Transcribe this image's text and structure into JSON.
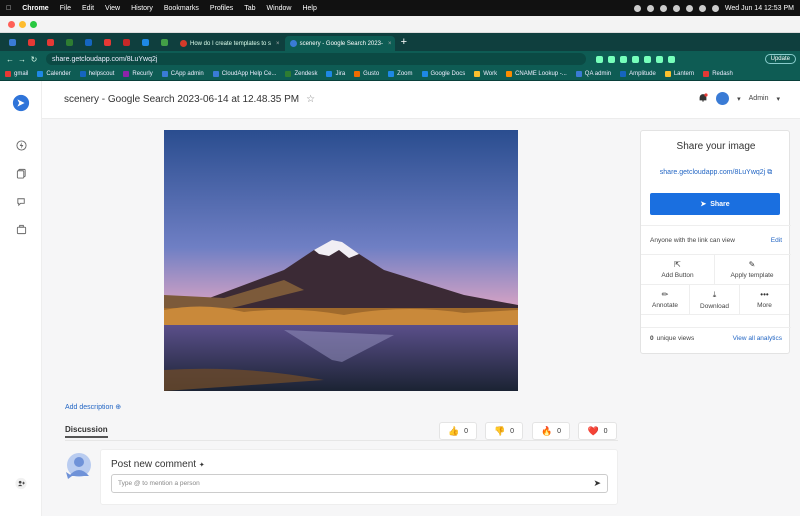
{
  "menubar": {
    "app_name": "Chrome",
    "items": [
      "File",
      "Edit",
      "View",
      "History",
      "Bookmarks",
      "Profiles",
      "Tab",
      "Window",
      "Help"
    ],
    "clock": "Wed Jun 14  12:53 PM"
  },
  "tabs": [
    {
      "label": "How do I create templates to s",
      "color": "#d43b2a",
      "active": false
    },
    {
      "label": "scenery - Google Search 2023-",
      "color": "#3a7bd5",
      "active": true
    }
  ],
  "pinned_tab_colors": [
    "#3a7bd5",
    "#e53935",
    "#e53935",
    "#2e7d32",
    "#1565c0",
    "#e53935",
    "#c62828",
    "#1e88e5",
    "#43a047"
  ],
  "address": {
    "url": "share.getcloudapp.com/8LuYwq2j",
    "update_label": "Update"
  },
  "bookmarks": [
    {
      "label": "gmail",
      "color": "#e53935"
    },
    {
      "label": "Calender",
      "color": "#1e88e5"
    },
    {
      "label": "helpscout",
      "color": "#1565c0"
    },
    {
      "label": "Recurly",
      "color": "#8e24aa"
    },
    {
      "label": "CApp admin",
      "color": "#3a7bd5"
    },
    {
      "label": "CloudApp Help Ce...",
      "color": "#3a7bd5"
    },
    {
      "label": "Zendesk",
      "color": "#2e7d32"
    },
    {
      "label": "Jira",
      "color": "#1e88e5"
    },
    {
      "label": "Gusto",
      "color": "#ef6c00"
    },
    {
      "label": "Zoom",
      "color": "#1e88e5"
    },
    {
      "label": "Google Docs",
      "color": "#1e88e5"
    },
    {
      "label": "Work",
      "color": "#fbc02d"
    },
    {
      "label": "CNAME Lookup -...",
      "color": "#fb8c00"
    },
    {
      "label": "QA admin",
      "color": "#3a7bd5"
    },
    {
      "label": "Amplitude",
      "color": "#1565c0"
    },
    {
      "label": "Lantern",
      "color": "#fbc02d"
    },
    {
      "label": "Redash",
      "color": "#e53935"
    }
  ],
  "page": {
    "title": "scenery - Google Search 2023-06-14 at 12.48.35 PM",
    "user_label": "Admin"
  },
  "share_panel": {
    "title": "Share your image",
    "share_url": "share.getcloudapp.com/8LuYwq2j",
    "share_button": "Share",
    "permission_text": "Anyone with the link can view",
    "edit_label": "Edit",
    "actions": {
      "add_button": "Add Button",
      "apply_template": "Apply template",
      "annotate": "Annotate",
      "download": "Download",
      "more": "More"
    },
    "views_count": "0",
    "views_label": "unique views",
    "analytics_link": "View all analytics"
  },
  "add_description": "Add description",
  "discussion": {
    "heading": "Discussion",
    "reactions": [
      {
        "emoji": "👍",
        "count": "0"
      },
      {
        "emoji": "👎",
        "count": "0"
      },
      {
        "emoji": "🔥",
        "count": "0"
      },
      {
        "emoji": "❤️",
        "count": "0"
      }
    ],
    "post_title": "Post new comment",
    "placeholder": "Type @ to mention a person"
  }
}
